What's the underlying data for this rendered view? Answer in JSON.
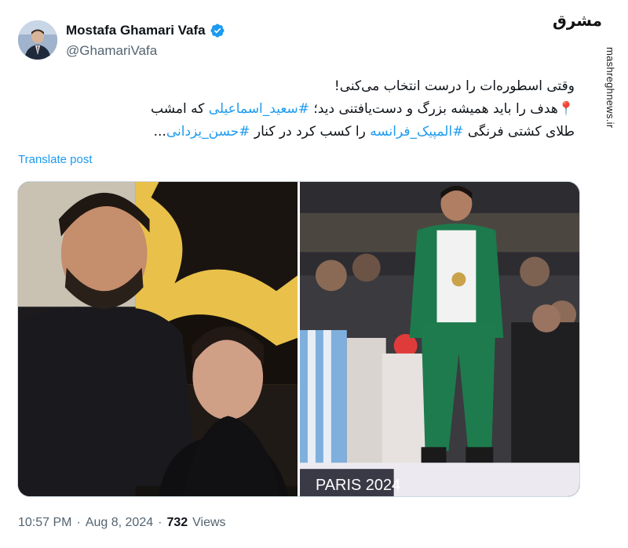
{
  "author": {
    "display_name": "Mostafa Ghamari Vafa",
    "handle": "@GhamariVafa",
    "verified": true
  },
  "post": {
    "line1": "وقتی اسطوره‌ات را درست انتخاب می‌کنی!",
    "line2_pin": "📍",
    "line2_text": "هدف را باید همیشه بزرگ و دست‌یافتنی دید؛ ",
    "line2_hashtag": "#سعید_اسماعیلی",
    "line2_tail": " که امشب",
    "line3_text_a": "طلای کشتی فرنگی ",
    "line3_hashtag_a": "#المپیک_فرانسه",
    "line3_text_b": " را کسب کرد در کنار ",
    "line3_hashtag_b": "#حسن_یزدانی",
    "line3_tail": "...",
    "translate_label": "Translate post"
  },
  "media": {
    "image_right_caption": "PARIS 2024"
  },
  "meta": {
    "time": "10:57 PM",
    "separator": "·",
    "date": "Aug 8, 2024",
    "views_count": "732",
    "views_label": "Views"
  },
  "watermark": {
    "logo_text": "مشرق",
    "site": "mashreghnews.ir"
  },
  "colors": {
    "link": "#1d9bf0",
    "secondary_text": "#536471",
    "primary_text": "#0f1419",
    "verified": "#1d9bf0"
  }
}
